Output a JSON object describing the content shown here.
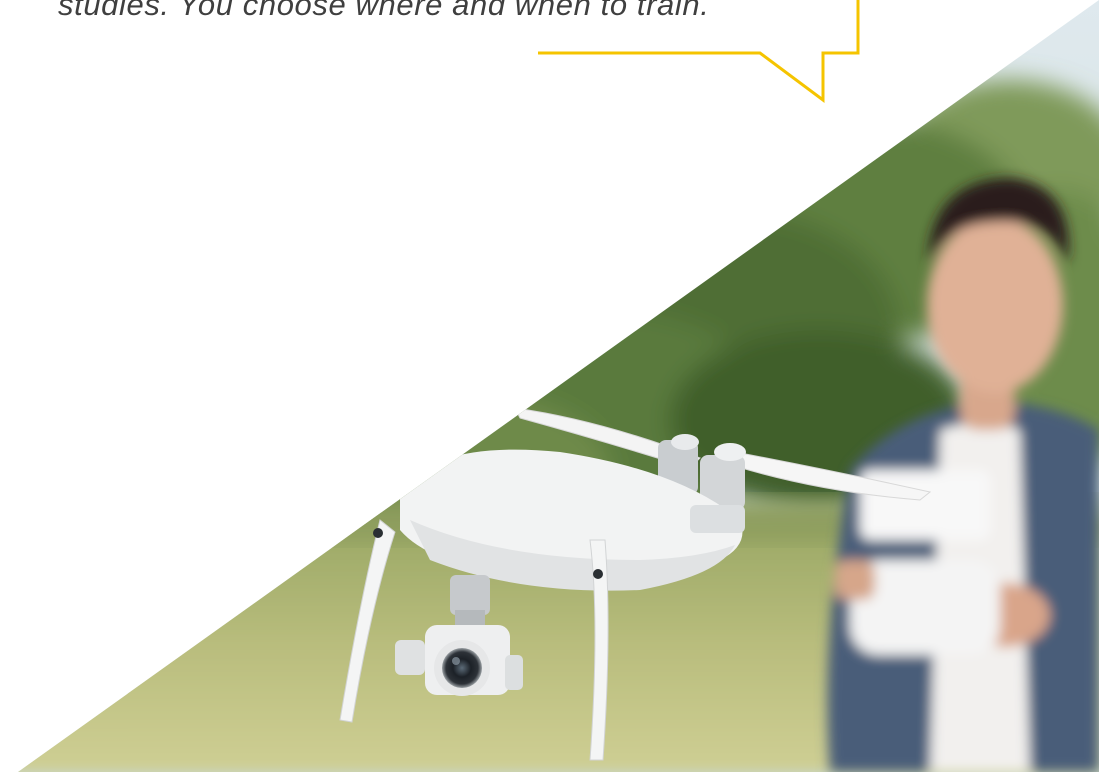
{
  "quote": {
    "text": "studies. You choose where and when to train."
  },
  "colors": {
    "accent": "#f5c400",
    "text": "#3f3f3f",
    "background": "#ffffff"
  },
  "photo": {
    "subject": "man-flying-white-drone"
  }
}
